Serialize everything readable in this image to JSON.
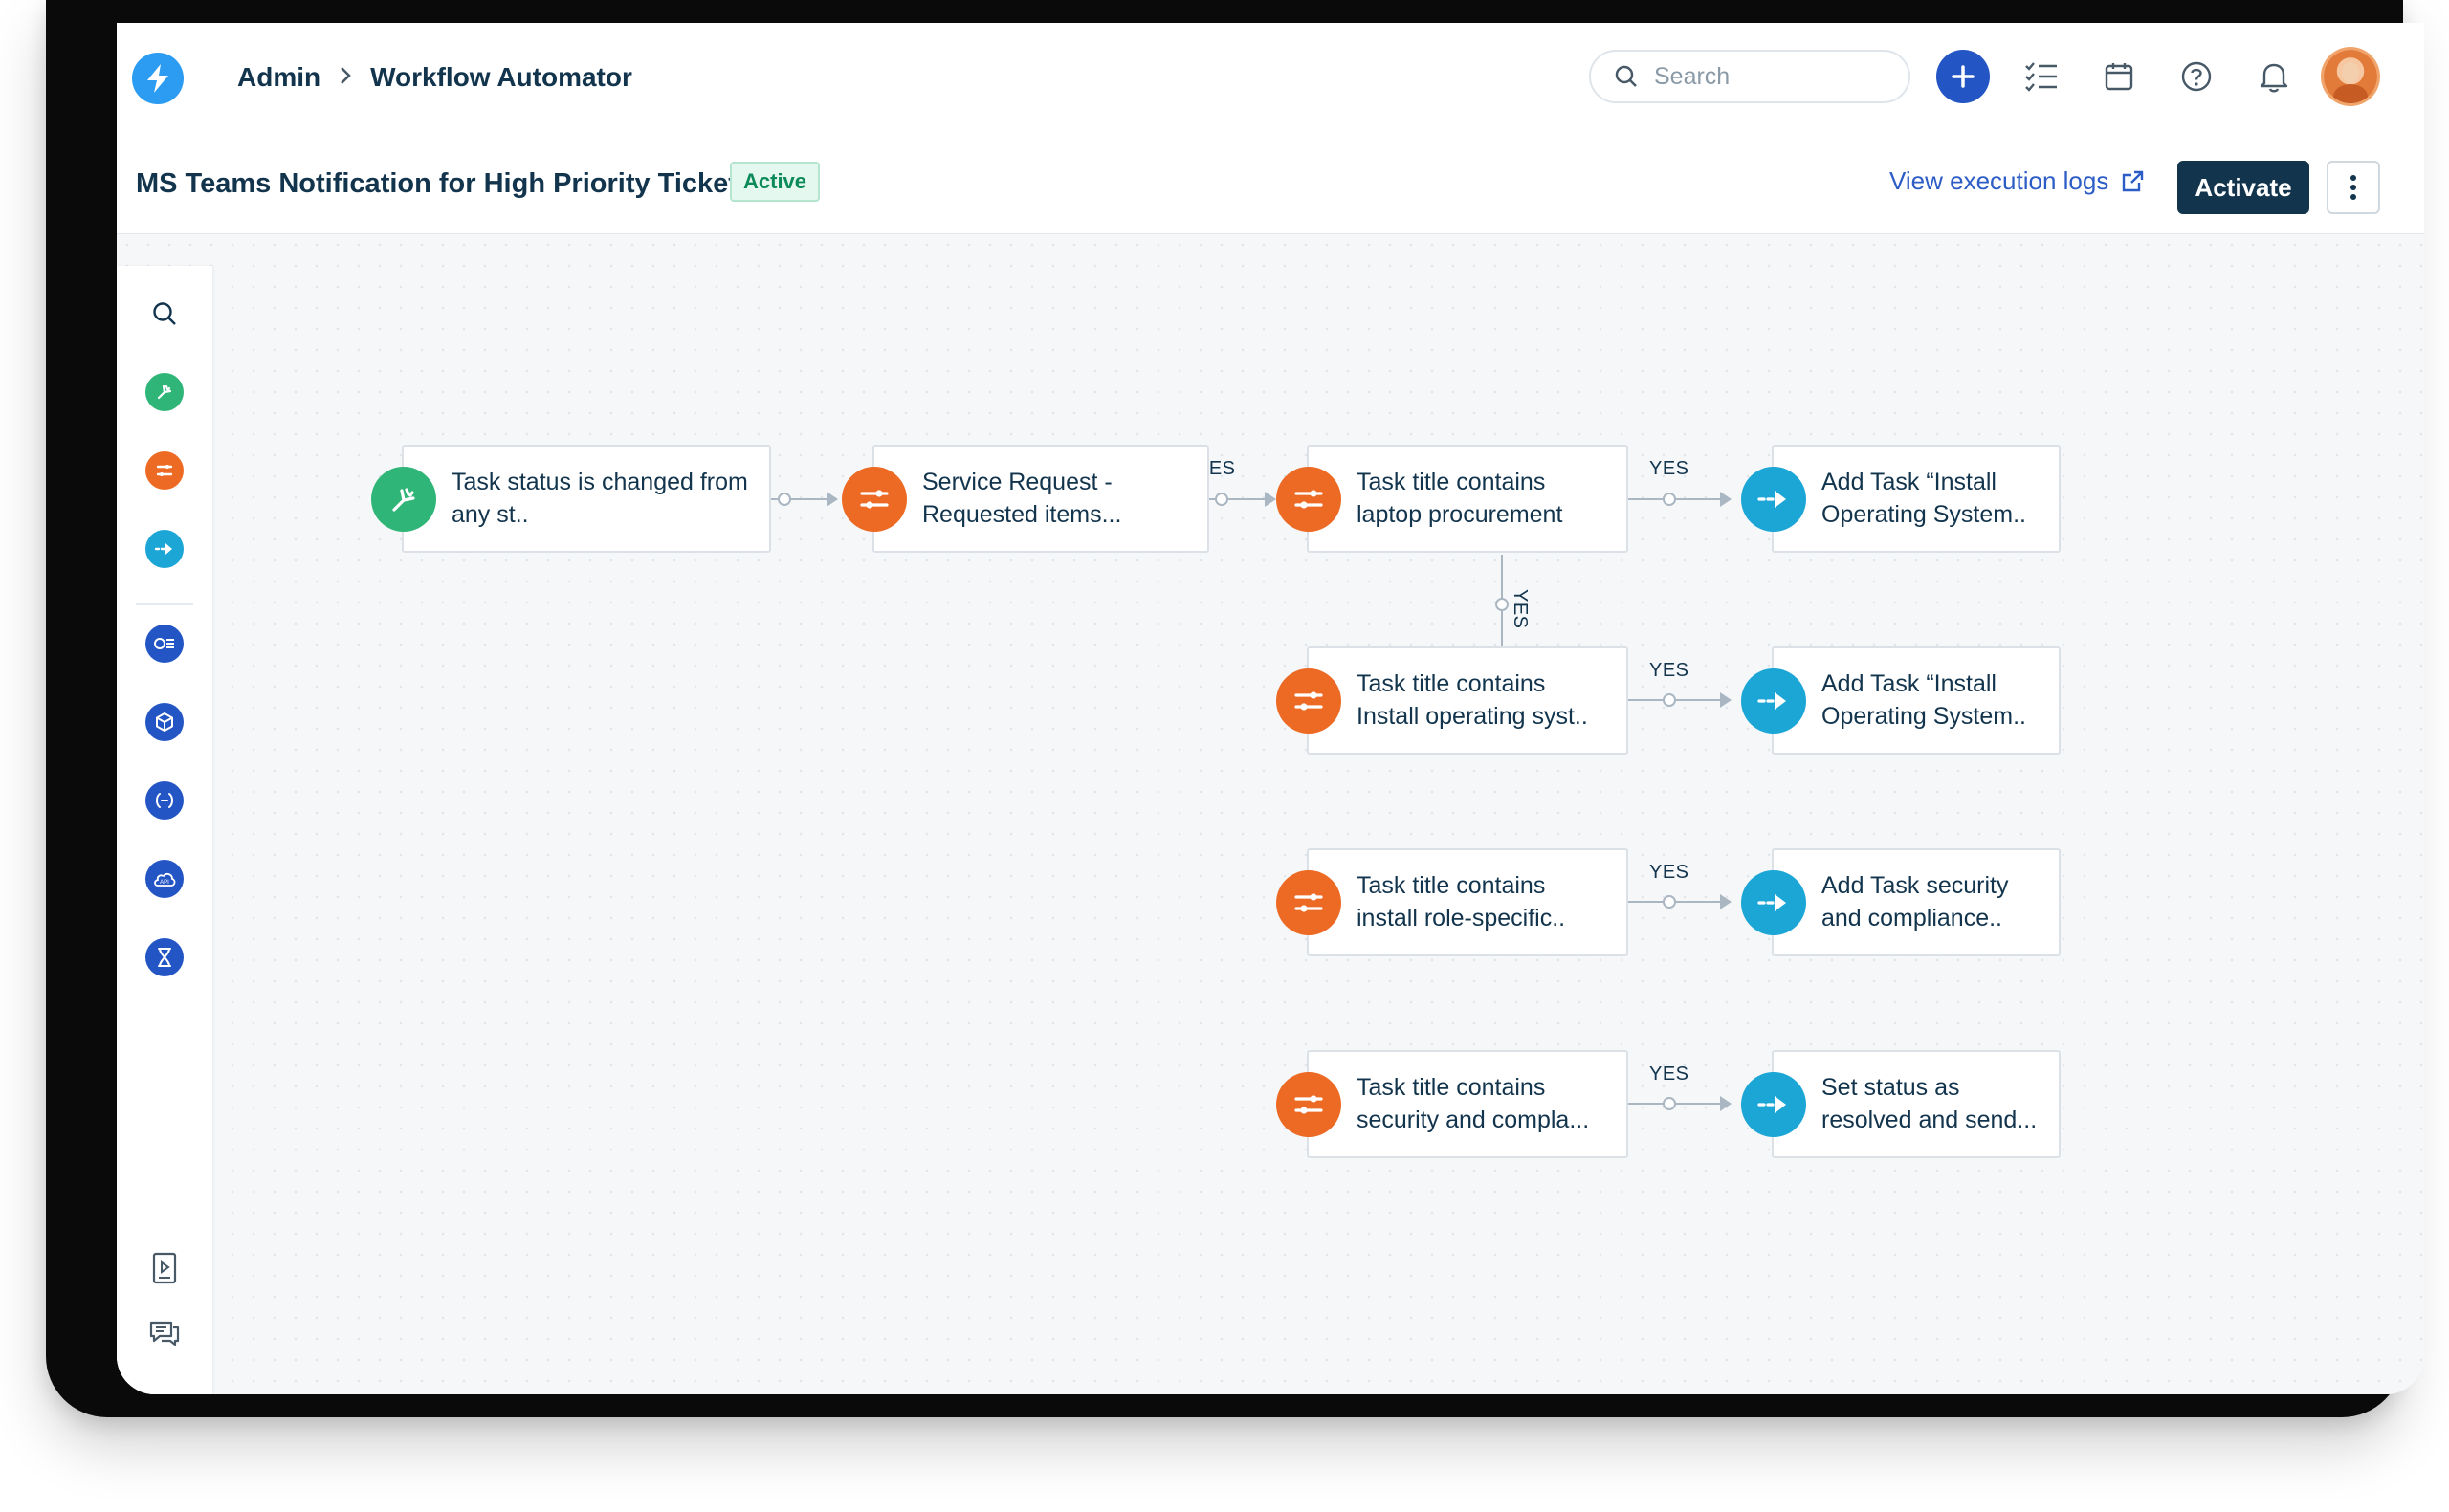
{
  "colors": {
    "primary_dark": "#12344d",
    "link_blue": "#2c5cc5",
    "trigger_green": "#2fb577",
    "condition_orange": "#ec6a23",
    "action_cyan": "#1ba6d6",
    "sidebar_blue": "#2355c4"
  },
  "topbar": {
    "logo_icon": "bolt-icon",
    "breadcrumb": [
      "Admin",
      "Workflow Automator"
    ],
    "search_placeholder": "Search",
    "icons": [
      "plus-icon",
      "checklist-icon",
      "calendar-icon",
      "help-icon",
      "bell-icon",
      "avatar"
    ]
  },
  "subheader": {
    "title": "MS Teams Notification for High Priority Ticket",
    "status_badge": "Active",
    "logs_link": "View execution logs",
    "activate_label": "Activate"
  },
  "leftbar": {
    "items": [
      "search-icon",
      "trigger-icon",
      "condition-icon",
      "action-icon",
      "query-icon",
      "cube-icon",
      "expression-icon",
      "api-icon",
      "timer-icon"
    ],
    "bottom_items": [
      "play-doc-icon",
      "chat-icon"
    ]
  },
  "workflow": {
    "connector_label": "YES",
    "nodes": {
      "trigger": "Task status is changed from any st..",
      "service_request": "Service Request - Requested items...",
      "cond1": "Task title contains laptop procurement",
      "action1": "Add Task “Install Operating System..",
      "cond2": "Task title contains Install operating syst..",
      "action2": "Add Task “Install Operating System..",
      "cond3": "Task title contains install role-specific..",
      "action3": "Add Task security and compliance..",
      "cond4": "Task title contains security and compla...",
      "action4": "Set status as resolved and send..."
    }
  }
}
